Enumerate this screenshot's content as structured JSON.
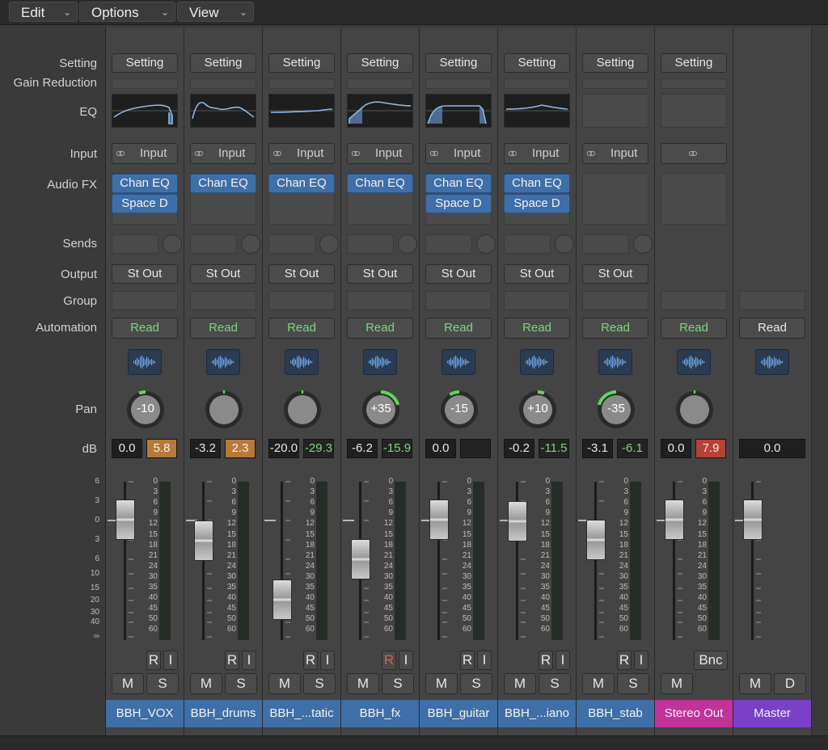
{
  "menus": [
    {
      "label": "Edit"
    },
    {
      "label": "Options"
    },
    {
      "label": "View"
    }
  ],
  "row_labels": {
    "setting": "Setting",
    "gain_reduction": "Gain Reduction",
    "eq": "EQ",
    "input": "Input",
    "audio_fx": "Audio FX",
    "sends": "Sends",
    "output": "Output",
    "group": "Group",
    "automation": "Automation",
    "pan": "Pan",
    "db": "dB"
  },
  "labels": {
    "setting_button": "Setting",
    "input_button": "Input",
    "output_button": "St Out",
    "r_button": "R",
    "i_button": "I",
    "m_button": "M",
    "s_button": "S",
    "d_button": "D",
    "bnc_button": "Bnc"
  },
  "meter_scale": [
    "0",
    "3",
    "6",
    "9",
    "12",
    "15",
    "18",
    "21",
    "24",
    "30",
    "35",
    "40",
    "45",
    "50",
    "60"
  ],
  "fader_scale": [
    "6",
    "3",
    "0",
    "3",
    "6",
    "10",
    "15",
    "20",
    "30",
    "40",
    "∞"
  ],
  "colors": {
    "audio": "#3f6fa8",
    "stereo_out": "#c1329b",
    "master": "#7a40c8",
    "read_green": "#7fd37f",
    "pan_ring": "#5fd65f"
  },
  "strips": [
    {
      "name": "BBH_VOX",
      "kind": "audio",
      "automation": "Read",
      "pan": "-10",
      "volume": "0.0",
      "peak": "5.8",
      "peak_style": "orange",
      "fader_db": 0,
      "eq": "a",
      "plugins": [
        "Chan EQ",
        "Space D"
      ],
      "buttons": [
        "R",
        "I"
      ],
      "has_solo": true
    },
    {
      "name": "BBH_drums",
      "kind": "audio",
      "automation": "Read",
      "pan": "",
      "volume": "-3.2",
      "peak": "2.3",
      "peak_style": "orange",
      "fader_db": -3.2,
      "eq": "b",
      "plugins": [
        "Chan EQ"
      ],
      "buttons": [
        "R",
        "I"
      ],
      "has_solo": true
    },
    {
      "name": "BBH_...tatic",
      "kind": "audio",
      "automation": "Read",
      "pan": "",
      "volume": "-20.0",
      "peak": "-29.3",
      "peak_style": "green",
      "fader_db": -20,
      "eq": "c",
      "plugins": [
        "Chan EQ"
      ],
      "buttons": [
        "R",
        "I"
      ],
      "has_solo": true
    },
    {
      "name": "BBH_fx",
      "kind": "audio",
      "automation": "Read",
      "pan": "+35",
      "volume": "-6.2",
      "peak": "-15.9",
      "peak_style": "green",
      "fader_db": -6.2,
      "eq": "d",
      "plugins": [
        "Chan EQ"
      ],
      "buttons": [
        "R",
        "I"
      ],
      "r_armed": true,
      "has_solo": true
    },
    {
      "name": "BBH_guitar",
      "kind": "audio",
      "automation": "Read",
      "pan": "-15",
      "volume": "0.0",
      "peak": "",
      "peak_style": "dark",
      "fader_db": 0,
      "eq": "e",
      "plugins": [
        "Chan EQ",
        "Space D"
      ],
      "buttons": [
        "R",
        "I"
      ],
      "has_solo": true
    },
    {
      "name": "BBH_...iano",
      "kind": "audio",
      "automation": "Read",
      "pan": "+10",
      "volume": "-0.2",
      "peak": "-11.5",
      "peak_style": "green",
      "fader_db": -0.2,
      "eq": "f",
      "plugins": [
        "Chan EQ",
        "Space D"
      ],
      "buttons": [
        "R",
        "I"
      ],
      "has_solo": true
    },
    {
      "name": "BBH_stab",
      "kind": "audio",
      "automation": "Read",
      "pan": "-35",
      "volume": "-3.1",
      "peak": "-6.1",
      "peak_style": "green",
      "fader_db": -3.1,
      "eq": "none",
      "plugins": [],
      "buttons": [
        "R",
        "I"
      ],
      "has_solo": true
    },
    {
      "name": "Stereo Out",
      "kind": "stereo_out",
      "automation": "Read",
      "pan": "",
      "volume": "0.0",
      "peak": "7.9",
      "peak_style": "red",
      "fader_db": 0,
      "eq": "none",
      "plugins": [],
      "buttons": [
        "Bnc"
      ],
      "has_solo": false
    },
    {
      "name": "Master",
      "kind": "master",
      "automation": "Read",
      "pan": "",
      "volume": "0.0",
      "peak": "",
      "peak_style": "none",
      "fader_db": 0,
      "eq": "hidden",
      "plugins": [],
      "buttons": [],
      "has_solo": false
    }
  ]
}
